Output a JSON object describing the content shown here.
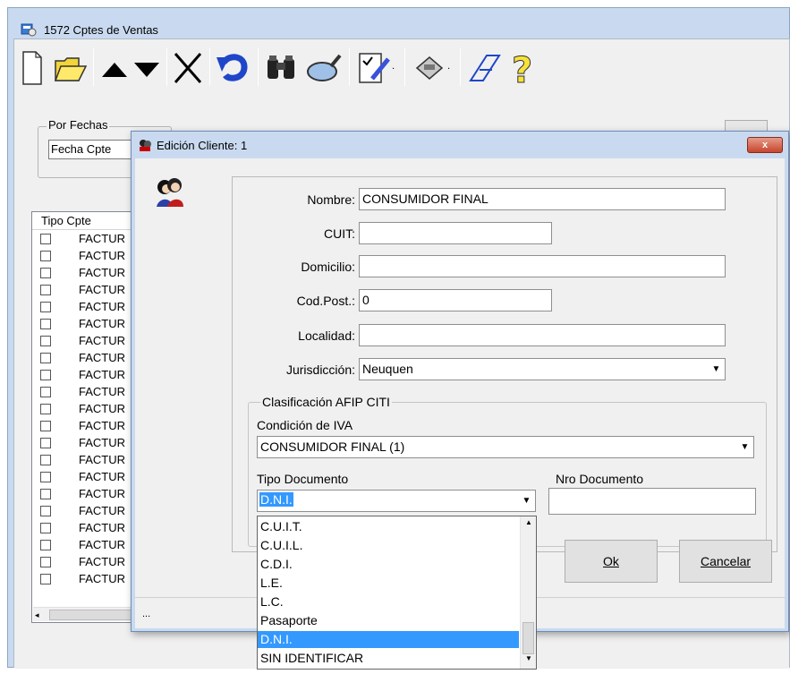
{
  "main_window": {
    "title": "1572 Cptes de Ventas"
  },
  "toolbar": {
    "icons": [
      "new-icon",
      "open-folder-icon",
      "arrow-up-icon",
      "arrow-down-icon",
      "delete-icon",
      "undo-icon",
      "binoculars-icon",
      "magnify-icon",
      "checklist-icon",
      "printer-icon",
      "text-icon",
      "help-icon"
    ]
  },
  "filter": {
    "group_label": "Por Fechas",
    "combo_value": "Fecha Cpte"
  },
  "list": {
    "header": "Tipo Cpte",
    "rows": [
      "FACTUR",
      "FACTUR",
      "FACTUR",
      "FACTUR",
      "FACTUR",
      "FACTUR",
      "FACTUR",
      "FACTUR",
      "FACTUR",
      "FACTUR",
      "FACTUR",
      "FACTUR",
      "FACTUR",
      "FACTUR",
      "FACTUR",
      "FACTUR",
      "FACTUR",
      "FACTUR",
      "FACTUR",
      "FACTUR",
      "FACTUR"
    ]
  },
  "dialog": {
    "title": "Edición Cliente: 1",
    "close_label": "x",
    "fields": {
      "nombre_label": "Nombre:",
      "nombre_value": "CONSUMIDOR FINAL",
      "cuit_label": "CUIT:",
      "cuit_value": "",
      "domicilio_label": "Domicilio:",
      "domicilio_value": "",
      "codpost_label": "Cod.Post.:",
      "codpost_value": "0",
      "localidad_label": "Localidad:",
      "localidad_value": "",
      "jurisdiccion_label": "Jurisdicción:",
      "jurisdiccion_value": "Neuquen"
    },
    "afip": {
      "group_label": "Clasificación AFIP CITI",
      "iva_label": "Condición de IVA",
      "iva_value": "CONSUMIDOR FINAL (1)",
      "tipo_doc_label": "Tipo Documento",
      "tipo_doc_value": "D.N.I.",
      "nro_doc_label": "Nro Documento",
      "nro_doc_value": ""
    },
    "buttons": {
      "ok": "Ok",
      "cancel": "Cancelar"
    },
    "status_text": "..."
  },
  "dropdown": {
    "items": [
      "C.U.I.T.",
      "C.U.I.L.",
      "C.D.I.",
      "L.E.",
      "L.C.",
      "Pasaporte",
      "D.N.I.",
      "SIN IDENTIFICAR"
    ],
    "selected_index": 6
  },
  "colors": {
    "window_frame": "#c9daf0",
    "selection": "#3399ff",
    "close_button": "#c7452c"
  }
}
